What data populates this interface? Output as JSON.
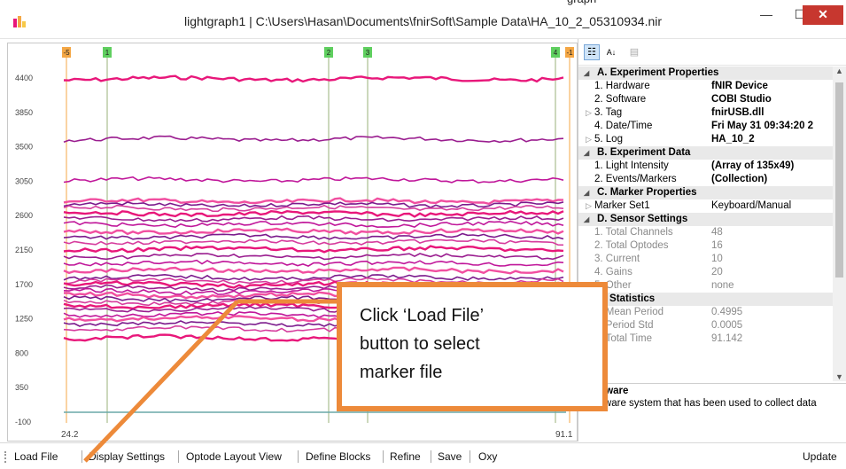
{
  "window": {
    "title": "lightgraph1 | C:\\Users\\Hasan\\Documents\\fnirSoft\\Sample Data\\HA_10_2_05310934.nir",
    "top_fragment": "graph",
    "minimize": "—",
    "maximize": "☐",
    "close": "✕"
  },
  "chart": {
    "y_ticks": [
      "4400",
      "3850",
      "3500",
      "3050",
      "2600",
      "2150",
      "1700",
      "1250",
      "800",
      "350",
      "-100"
    ],
    "x_ticks": [
      "24.2",
      "91.1"
    ],
    "markers": [
      {
        "label": "-5",
        "color": "#f4a745"
      },
      {
        "label": "1",
        "color": "#5fcf5f"
      },
      {
        "label": "2",
        "color": "#5fcf5f"
      },
      {
        "label": "3",
        "color": "#5fcf5f"
      },
      {
        "label": "4",
        "color": "#5fcf5f"
      },
      {
        "label": "-1",
        "color": "#f4a745"
      }
    ],
    "series_colors": [
      "#e8177a",
      "#9a1d8f",
      "#c0179a",
      "#f14fa0",
      "#7b1a8c",
      "#d63c9d"
    ]
  },
  "panel": {
    "toolbar": {
      "categorized": "☷",
      "alphabetical": "A↓",
      "pages": "▤"
    },
    "sections": [
      {
        "title": "A. Experiment Properties",
        "props": [
          {
            "name": "1. Hardware",
            "value": "fNIR Device",
            "expand": ""
          },
          {
            "name": "2. Software",
            "value": "COBI Studio",
            "expand": ""
          },
          {
            "name": "3. Tag",
            "value": "fnirUSB.dll",
            "expand": "▷"
          },
          {
            "name": "4. Date/Time",
            "value": "Fri May 31 09:34:20 2",
            "expand": ""
          },
          {
            "name": "5. Log",
            "value": "HA_10_2",
            "expand": "▷"
          }
        ]
      },
      {
        "title": "B. Experiment Data",
        "props": [
          {
            "name": "1. Light Intensity",
            "value": "(Array of 135x49)",
            "expand": ""
          },
          {
            "name": "2. Events/Markers",
            "value": "(Collection)",
            "expand": ""
          }
        ]
      },
      {
        "title": "C. Marker Properties",
        "props": [
          {
            "name": "Marker Set1",
            "value": "Keyboard/Manual",
            "expand": "▷",
            "normal": true
          }
        ]
      },
      {
        "title": "D. Sensor Settings",
        "props": [
          {
            "name": "1. Total Channels",
            "value": "48",
            "expand": "",
            "dim": true
          },
          {
            "name": "2. Total Optodes",
            "value": "16",
            "expand": "",
            "dim": true
          },
          {
            "name": "3. Current",
            "value": "10",
            "expand": "",
            "dim": true
          },
          {
            "name": "4. Gains",
            "value": "20",
            "expand": "",
            "dim": true
          },
          {
            "name": "5. Other",
            "value": "none",
            "expand": "",
            "dim": true
          }
        ]
      },
      {
        "title": "E. Statistics",
        "props": [
          {
            "name": "1. Mean Period",
            "value": "0.4995",
            "expand": "",
            "dim": true
          },
          {
            "name": "2. Period Std",
            "value": "0.0005",
            "expand": "",
            "dim": true
          },
          {
            "name": "3. Total Time",
            "value": "91.142",
            "expand": "",
            "dim": true
          }
        ]
      }
    ],
    "description": {
      "title": "Hardware",
      "text": "Hardware system that has been used to collect data"
    }
  },
  "toolbar": {
    "load_file": "Load File",
    "display_settings": "Display Settings",
    "optode_layout": "Optode Layout View",
    "define_blocks": "Define Blocks",
    "refine": "Refine",
    "save": "Save",
    "oxy": "Oxy",
    "update": "Update"
  },
  "callout": {
    "line1": "Click ‘Load File’",
    "line2": "button to select",
    "line3": "marker file",
    "accent": "#ed8a3a"
  }
}
